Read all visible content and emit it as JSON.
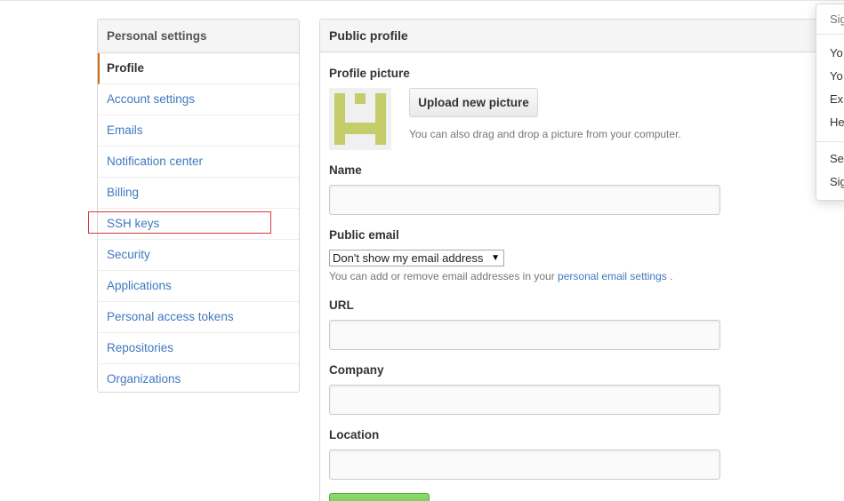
{
  "sidebar": {
    "header": "Personal settings",
    "items": [
      {
        "label": "Profile",
        "selected": true
      },
      {
        "label": "Account settings"
      },
      {
        "label": "Emails"
      },
      {
        "label": "Notification center"
      },
      {
        "label": "Billing"
      },
      {
        "label": "SSH keys"
      },
      {
        "label": "Security"
      },
      {
        "label": "Applications"
      },
      {
        "label": "Personal access tokens"
      },
      {
        "label": "Repositories"
      },
      {
        "label": "Organizations"
      }
    ]
  },
  "main": {
    "title": "Public profile",
    "picture": {
      "label": "Profile picture",
      "upload_label": "Upload new picture",
      "hint": "You can also drag and drop a picture from your computer."
    },
    "name": {
      "label": "Name",
      "value": ""
    },
    "public_email": {
      "label": "Public email",
      "selected": "Don't show my email address",
      "hint_prefix": "You can add or remove email addresses in your",
      "hint_link": "personal email settings",
      "hint_suffix": "."
    },
    "url": {
      "label": "URL",
      "value": ""
    },
    "company": {
      "label": "Company",
      "value": ""
    },
    "location": {
      "label": "Location",
      "value": ""
    }
  },
  "dropdown": {
    "header": "Sig",
    "items": [
      "Yo",
      "Yo",
      "Ex",
      "He"
    ],
    "items2": [
      "Se",
      "Sig"
    ]
  },
  "colors": {
    "link": "#4078c0",
    "selected_accent": "#d26911",
    "avatar": "#c5cc6a",
    "highlight_box": "#d9363b",
    "update_button": "#60b044"
  },
  "icons": {
    "avatar": "identicon-avatar",
    "select_arrow": "triangle-down-icon"
  }
}
